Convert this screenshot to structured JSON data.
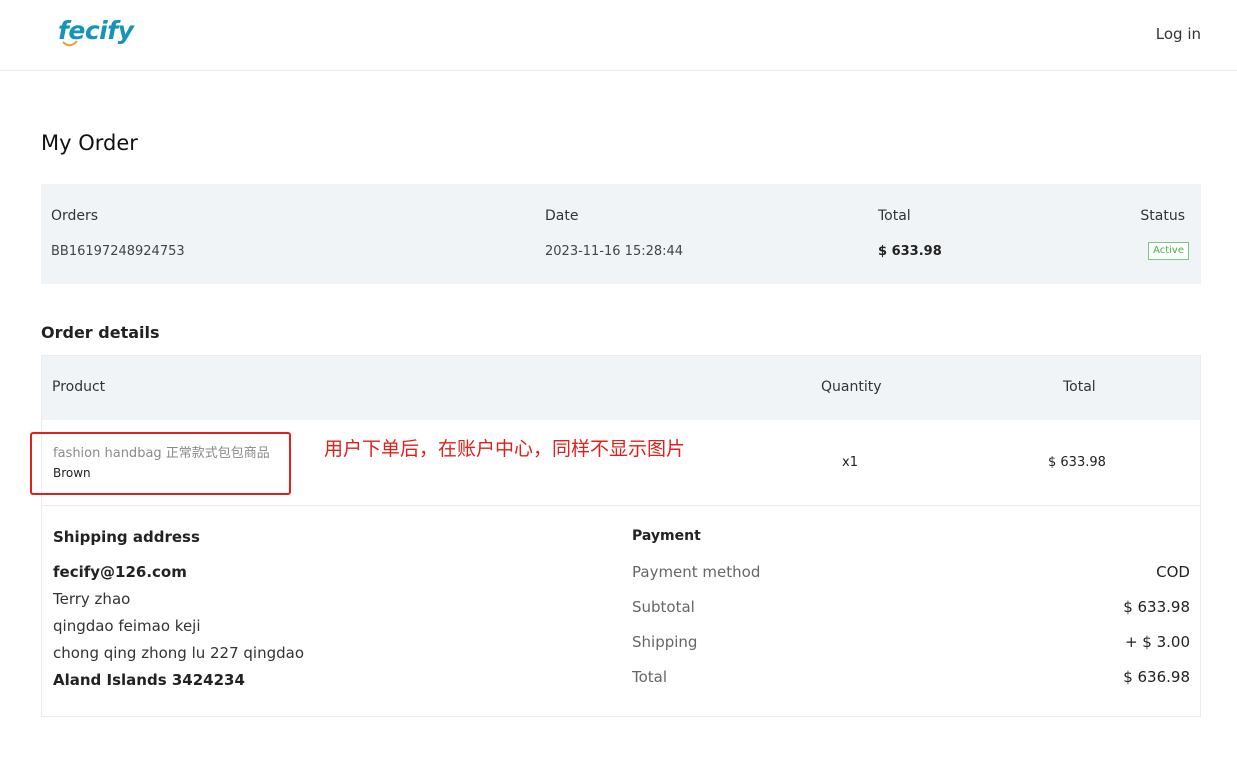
{
  "header": {
    "logo_text": "fecify",
    "login_label": "Log in"
  },
  "page_title": "My Order",
  "order_summary": {
    "orders_label": "Orders",
    "date_label": "Date",
    "total_label": "Total",
    "status_label": "Status",
    "order_number": "BB16197248924753",
    "order_date": "2023-11-16 15:28:44",
    "order_total": "$ 633.98",
    "status": "Active"
  },
  "order_details": {
    "title": "Order details",
    "columns": {
      "product": "Product",
      "quantity": "Quantity",
      "total": "Total"
    },
    "items": [
      {
        "name": "fashion handbag 正常款式包包商品",
        "variant": "Brown",
        "quantity": "x1",
        "total": "$ 633.98"
      }
    ]
  },
  "annotation": "用户下单后，在账户中心，同样不显示图片",
  "shipping": {
    "title": "Shipping address",
    "email": "fecify@126.com",
    "name": "Terry zhao",
    "company": "qingdao feimao keji",
    "street": "chong qing zhong lu 227 qingdao",
    "region": "Aland Islands 3424234"
  },
  "payment": {
    "title": "Payment",
    "method_label": "Payment method",
    "method_value": "COD",
    "subtotal_label": "Subtotal",
    "subtotal_value": "$ 633.98",
    "shipping_label": "Shipping",
    "shipping_value": "+ $ 3.00",
    "total_label": "Total",
    "total_value": "$ 636.98"
  },
  "colors": {
    "brand": "#1594b8",
    "status_green": "#4caf50",
    "annotation_red": "#e0201b",
    "panel_bg": "#f1f4f7"
  }
}
